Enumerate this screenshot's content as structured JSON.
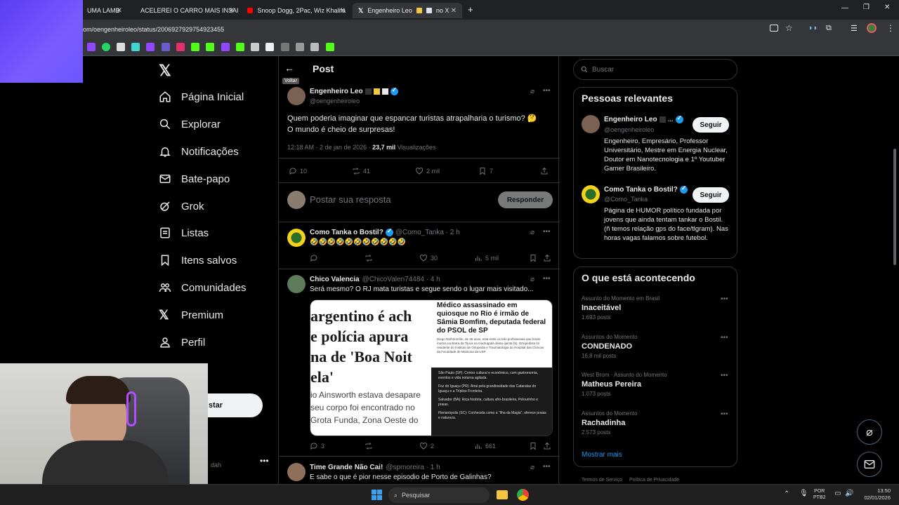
{
  "browser": {
    "tabs": [
      {
        "label": "UMA LAMB"
      },
      {
        "label": "ACELEREI O CARRO MAIS INSAI"
      },
      {
        "label": "Snoop Dogg, 2Pac, Wiz Khalifa"
      },
      {
        "label": "Engenheiro Leo"
      },
      {
        "label": "no X"
      }
    ],
    "url": "om/oengenheiroleo/status/2006927929754923455"
  },
  "nav": {
    "home": "Página Inicial",
    "explore": "Explorar",
    "notifications": "Notificações",
    "chat": "Bate-papo",
    "grok": "Grok",
    "lists": "Listas",
    "bookmarks": "Itens salvos",
    "communities": "Comunidades",
    "premium": "Premium",
    "profile": "Perfil",
    "post_button_partial": "star",
    "account_handle_partial": "dah"
  },
  "header": {
    "title": "Post",
    "back_tooltip": "Voltar"
  },
  "main_post": {
    "author": "Engenheiro Leo",
    "handle": "@oengenheiroleo",
    "text_line1": "Quem poderia imaginar que espancar turistas atrapalharia o turismo? 🤔",
    "text_line2": "O mundo é cheio de surpresas!",
    "time": "12:18 AM · 2 de jan de 2026 ·",
    "views": "23,7 mil",
    "views_label": "Visualizações",
    "replies": "10",
    "reposts": "41",
    "likes": "2 mil",
    "bookmarks": "7"
  },
  "reply_box": {
    "placeholder": "Postar sua resposta",
    "button": "Responder"
  },
  "replies": [
    {
      "author": "Como Tanka o Bostil?",
      "handle": "@Como_Tanka · 2 h",
      "text": "🤣🤣🤣🤣🤣🤣🤣🤣🤣🤣🤣",
      "replies": "",
      "reposts": "",
      "likes": "30",
      "views": "5 mil"
    },
    {
      "author": "Chico Valencia",
      "handle": "@ChicoValen74484 · 4 h",
      "text": "Será mesmo? O RJ mata turistas e segue sendo o lugar mais visitado...",
      "replies": "3",
      "reposts": "",
      "likes": "2",
      "views": "661",
      "image": {
        "left_lines": [
          "argentino é ach",
          "e polícia apura",
          "na de 'Boa Noit",
          "ela'"
        ],
        "left_small": [
          "io Ainsworth estava desapare",
          "seu corpo foi encontrado no",
          "Grota Funda, Zona Oeste do"
        ],
        "right_headline": "Médico assassinado em quiosque no Rio é irmão de Sâmia Bomfim, deputada federal do PSOL de SP",
        "right_body": "Diego Ralf Bomfim, de 35 anos, está entre os três profissionais que foram mortos na Barra da Tijuca na madrugada desta quinta (5). Ortopedista foi residente do Instituto de Ortopedia e Traumatologia do Hospital das Clínicas da Faculdade de Medicina da USP.",
        "right_list": [
          "São Paulo (SP): Centro cultural e econômico, com gastronomia, eventos e vida noturna agitada.",
          "Foz do Iguaçu (PR): Atrai pela grandiosidade das Cataratas do Iguaçu e a Tríplice Fronteira.",
          "Salvador (BA): Rica história, cultura afro-brasileira, Pelourinho e praias.",
          "Florianópolis (SC): Conhecida como a \"Ilha da Magia\", oferece praias e natureza."
        ]
      }
    },
    {
      "author": "Time Grande Não Cai!",
      "handle": "@spmoreira · 1 h",
      "text": "E sabe o que é pior nesse episodio de Porto de Galinhas?"
    }
  ],
  "search": {
    "placeholder": "Buscar"
  },
  "relevant": {
    "title": "Pessoas relevantes",
    "people": [
      {
        "name": "Engenheiro Leo",
        "handle": "@oengenheiroleo",
        "button": "Seguir",
        "bio": "Engenheiro, Empresário, Professor Universitário, Mestre em Energia Nuclear, Doutor em Nanotecnologia e 1º Youtuber Gamer Brasileiro."
      },
      {
        "name": "Como Tanka o Bostil?",
        "handle": "@Como_Tanka",
        "button": "Seguir",
        "bio": "Página de HUMOR político fundada por jovens que ainda tentam tankar o Bostil. (ñ temos relação gps do face/tlgram). Nas horas vagas falamos sobre futebol."
      }
    ]
  },
  "trends": {
    "title": "O que está acontecendo",
    "items": [
      {
        "context": "Assunto do Momento em Brasil",
        "name": "Inaceitável",
        "posts": "1.693 posts"
      },
      {
        "context": "Assuntos do Momento",
        "name": "CONDENADO",
        "posts": "16,8 mil posts"
      },
      {
        "context": "West Brom · Assunto do Momento",
        "name": "Matheus Pereira",
        "posts": "1.073 posts"
      },
      {
        "context": "Assuntos do Momento",
        "name": "Rachadinha",
        "posts": "2.573 posts"
      }
    ],
    "more": "Mostrar mais"
  },
  "footer": {
    "terms": "Termos de Serviço",
    "privacy": "Política de Privacidade"
  },
  "taskbar": {
    "search": "Pesquisar",
    "lang": "POR",
    "layout": "PTB2",
    "time": "13:50",
    "date": "02/01/2026"
  },
  "colors": {
    "accent": "#1d9bf0",
    "bg": "#000000",
    "border": "#2f3336",
    "muted": "#71767b"
  }
}
